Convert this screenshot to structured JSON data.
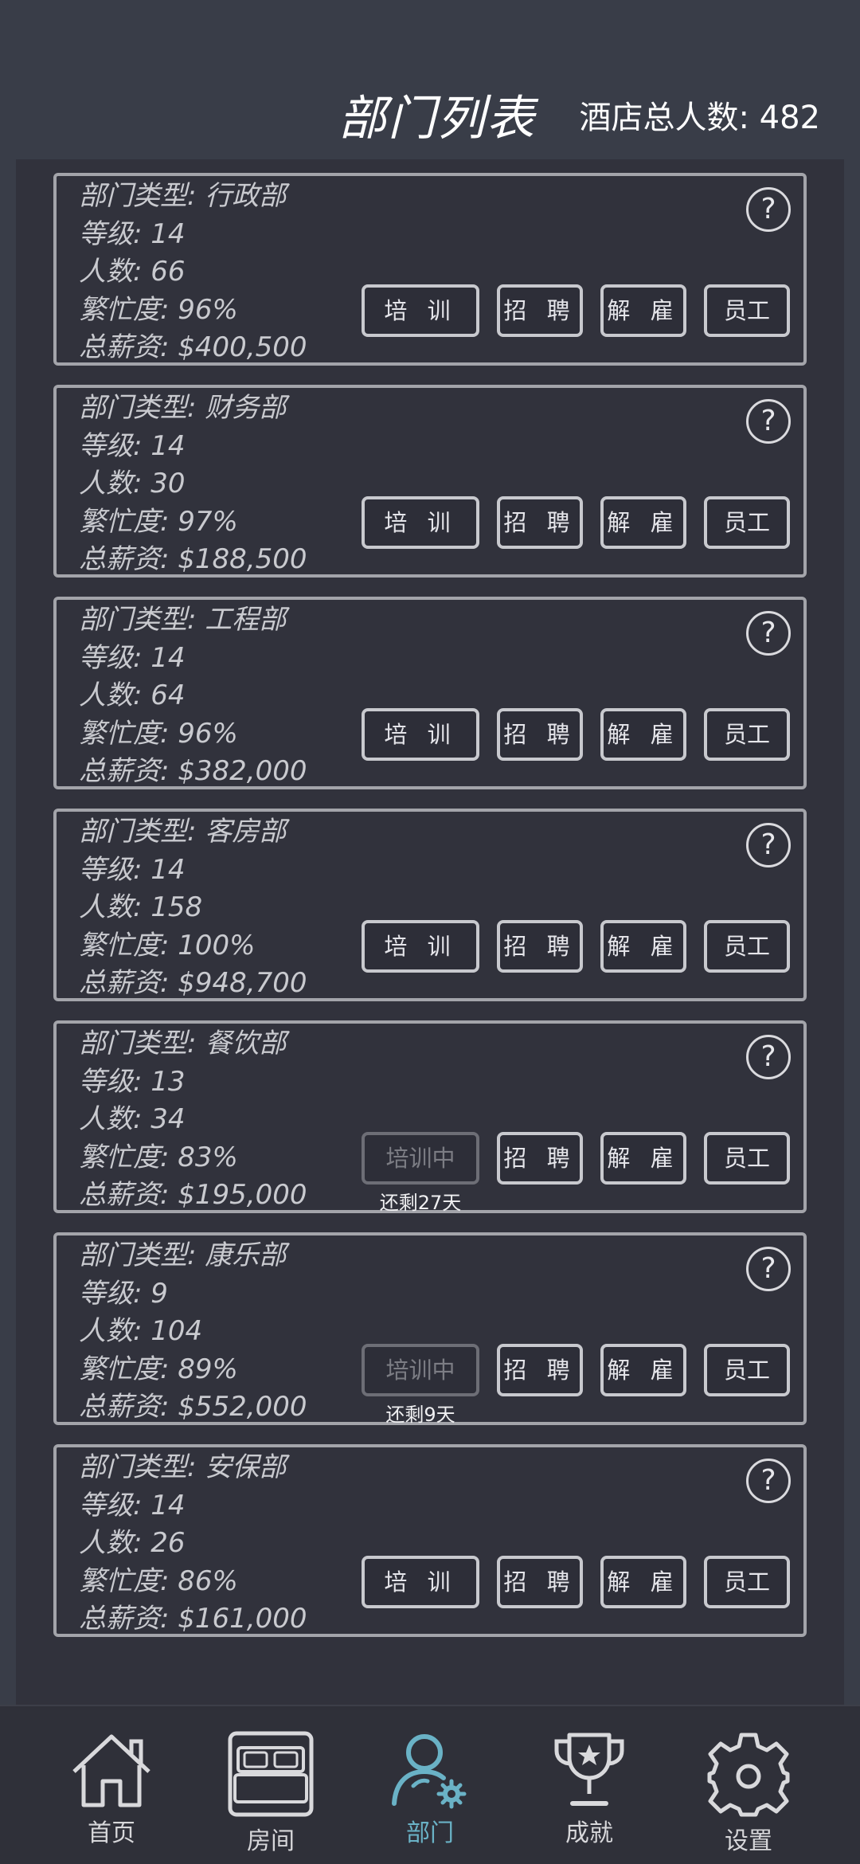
{
  "header": {
    "title": "部门列表",
    "total_staff": "酒店总人数: 482"
  },
  "departments": [
    {
      "type": "部门类型: 行政部",
      "level": "等级: 14",
      "count": "人数: 66",
      "busy": "繁忙度: 96%",
      "salary": "总薪资: $400,500",
      "train_label": "培 训",
      "remaining": ""
    },
    {
      "type": "部门类型: 财务部",
      "level": "等级: 14",
      "count": "人数: 30",
      "busy": "繁忙度: 97%",
      "salary": "总薪资: $188,500",
      "train_label": "培 训",
      "remaining": ""
    },
    {
      "type": "部门类型: 工程部",
      "level": "等级: 14",
      "count": "人数: 64",
      "busy": "繁忙度: 96%",
      "salary": "总薪资: $382,000",
      "train_label": "培 训",
      "remaining": ""
    },
    {
      "type": "部门类型: 客房部",
      "level": "等级: 14",
      "count": "人数: 158",
      "busy": "繁忙度: 100%",
      "salary": "总薪资: $948,700",
      "train_label": "培 训",
      "remaining": ""
    },
    {
      "type": "部门类型: 餐饮部",
      "level": "等级: 13",
      "count": "人数: 34",
      "busy": "繁忙度: 83%",
      "salary": "总薪资: $195,000",
      "train_label": "培训中",
      "remaining": "还剩27天"
    },
    {
      "type": "部门类型: 康乐部",
      "level": "等级: 9",
      "count": "人数: 104",
      "busy": "繁忙度: 89%",
      "salary": "总薪资: $552,000",
      "train_label": "培训中",
      "remaining": "还剩9天"
    },
    {
      "type": "部门类型: 安保部",
      "level": "等级: 14",
      "count": "人数: 26",
      "busy": "繁忙度: 86%",
      "salary": "总薪资: $161,000",
      "train_label": "培 训",
      "remaining": ""
    }
  ],
  "buttons": {
    "recruit": "招 聘",
    "fire": "解 雇",
    "staff": "员工",
    "help": "?"
  },
  "nav": {
    "items": [
      {
        "label": "首页",
        "icon": "home-icon"
      },
      {
        "label": "房间",
        "icon": "bed-icon"
      },
      {
        "label": "部门",
        "icon": "staff-gear-icon"
      },
      {
        "label": "成就",
        "icon": "trophy-icon"
      },
      {
        "label": "设置",
        "icon": "gear-icon"
      }
    ],
    "active_index": 2,
    "active_color": "#6ab2c6"
  }
}
